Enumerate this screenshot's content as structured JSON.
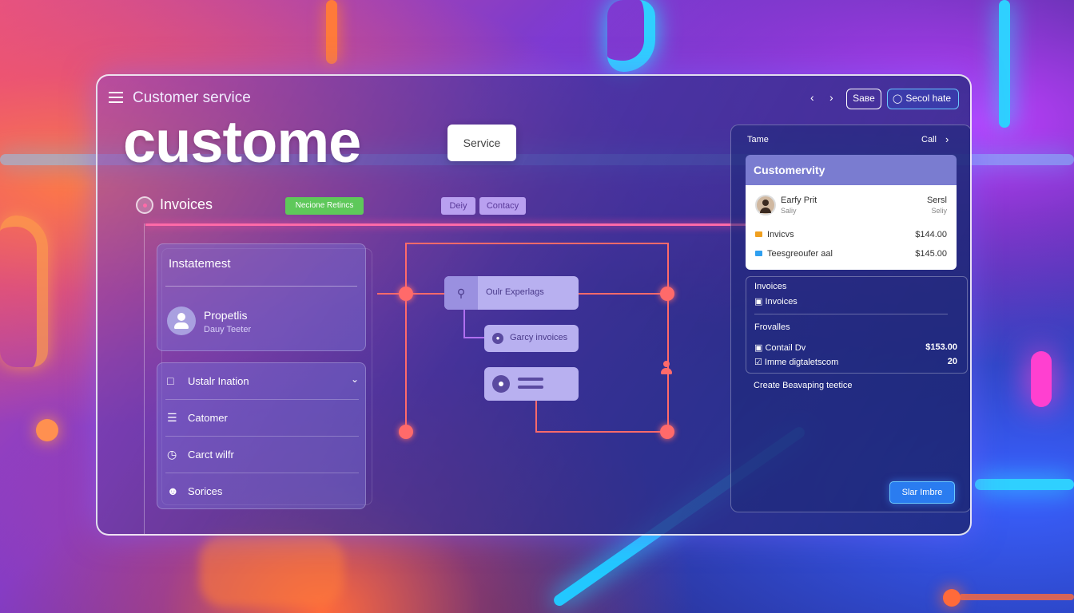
{
  "colors": {
    "accent_pink": "#ff6aa8",
    "flow_red": "#ff6a6a",
    "tag_green": "#5ec85a",
    "tag_purple": "#b9a0f0",
    "button_blue": "#2a7cf0"
  },
  "header": {
    "menu_icon": "hamburger-icon",
    "title": "Customer service",
    "prev_icon": "chevron-left-icon",
    "next_icon": "chevron-right-icon",
    "save_label": "Saвe",
    "social_icon": "chat-bubble-icon",
    "social_label": "Secol hate"
  },
  "hero": {
    "title": "custome",
    "chip": "Service"
  },
  "toolbar": {
    "invoices_label": "Invoices",
    "green_tag": "Necione Retincs",
    "tag_duty": "Deiy",
    "tag_contact": "Contacy"
  },
  "left_panel": {
    "heading": "Instatemest",
    "profile_name": "Propetlis",
    "profile_sub": "Dauy Teeter",
    "menu": [
      {
        "icon": "window-icon",
        "label": "Ustalr Ination"
      },
      {
        "icon": "list-icon",
        "label": "Catomer"
      },
      {
        "icon": "clock-icon",
        "label": "Carct wilfr"
      },
      {
        "icon": "users-icon",
        "label": "Sorices"
      }
    ]
  },
  "flow": {
    "node_1": "Oulr Experlags",
    "node_2": "Garcy invoices"
  },
  "right_panel": {
    "head_left": "Tame",
    "head_right": "Call",
    "banner": "Customervity",
    "card": {
      "name": "Earfy Prit",
      "name_sub": "Saliy",
      "tag": "Sersl",
      "tag_sub": "Seliy",
      "rows": [
        {
          "label": "Invicvs",
          "amount": "$144.00",
          "color": "#f0a020"
        },
        {
          "label": "Teesgreoufer aal",
          "amount": "$145.00",
          "color": "#30a0f0"
        }
      ]
    },
    "box": {
      "title": "Invoices",
      "item": "Invoices",
      "section": "Frovalles",
      "rows": [
        {
          "label": "Contail Dv",
          "amount": "$153.00"
        },
        {
          "label": "Imme digtaletscom",
          "amount": "20"
        }
      ]
    },
    "create_text": "Create Beavaping teetice",
    "button": "Slar Imbre"
  }
}
